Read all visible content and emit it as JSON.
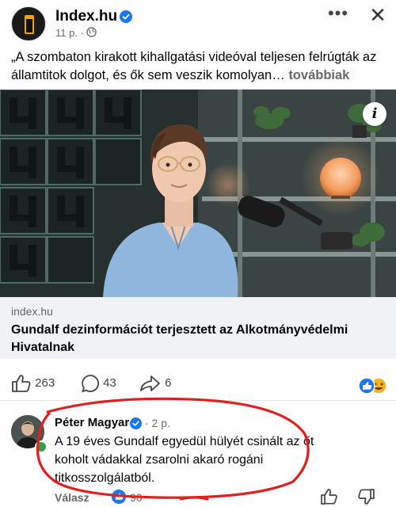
{
  "post": {
    "page_name": "Index.hu",
    "time": "11 p. ·",
    "text": "„A szombaton kirakott kihallgatási videóval teljesen felrúgták az államtitok dolgot, és ők sem veszik komolyan…",
    "see_more": "továbbiak",
    "media_info_icon": "i",
    "link_domain": "index.hu",
    "link_title": "Gundalf dezinformációt terjesztett az Alkotmányvédelmi Hivatalnak",
    "like_count": "263",
    "comment_count": "43",
    "share_count": "6"
  },
  "comment": {
    "author": "Péter Magyar",
    "time": "· 2 p.",
    "text": "A 19 éves Gundalf egyedül hülyét csinált az őt koholt vádakkal zsarolni akaró rogáni titkosszolgálatból.",
    "reply_label": "Válasz",
    "reaction_count": "90"
  },
  "icons": {
    "more": "more-horizontal-icon",
    "close": "close-icon",
    "verified": "verified-badge-icon",
    "globe": "globe-icon",
    "like": "thumb-up-icon",
    "comment": "comment-bubble-icon",
    "share": "share-arrow-icon"
  },
  "colors": {
    "accent": "#1877f2",
    "annotation": "#e0201f",
    "secondary_text": "#65676b"
  }
}
